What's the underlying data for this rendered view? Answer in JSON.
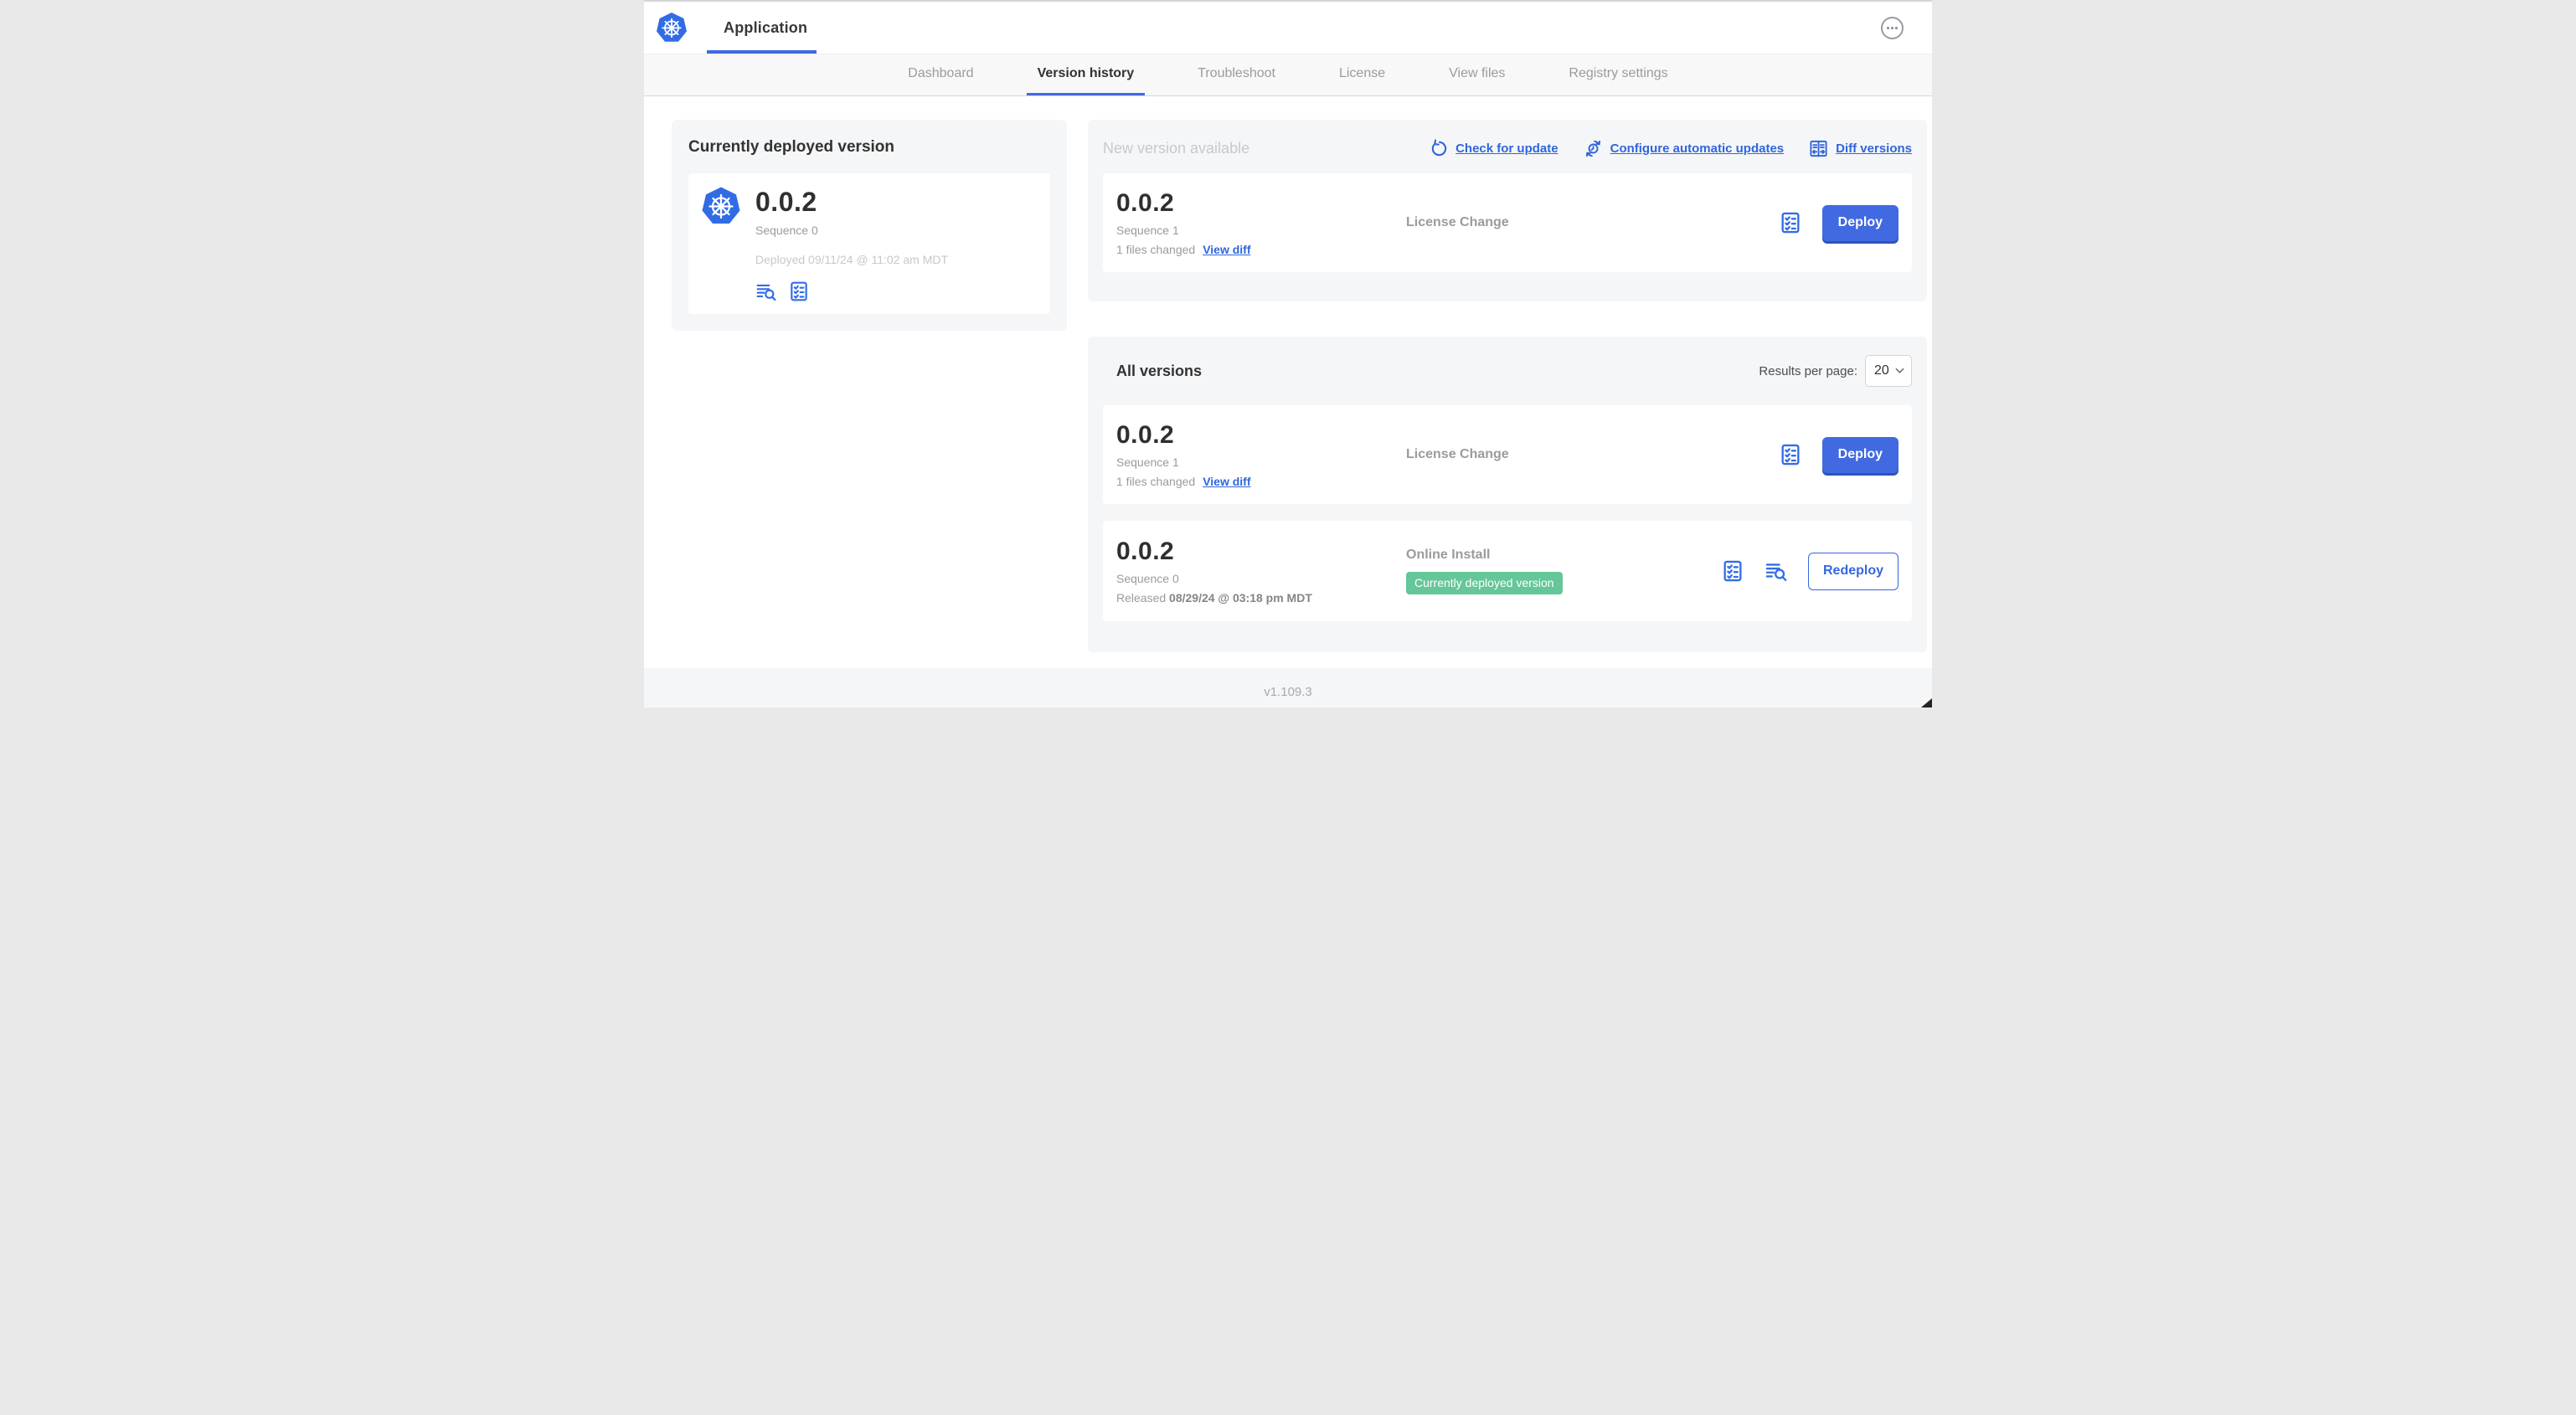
{
  "header": {
    "app_title": "Application"
  },
  "nav": {
    "tabs": [
      {
        "label": "Dashboard",
        "active": false
      },
      {
        "label": "Version history",
        "active": true
      },
      {
        "label": "Troubleshoot",
        "active": false
      },
      {
        "label": "License",
        "active": false
      },
      {
        "label": "View files",
        "active": false
      },
      {
        "label": "Registry settings",
        "active": false
      }
    ]
  },
  "current": {
    "title": "Currently deployed version",
    "version": "0.0.2",
    "sequence": "Sequence 0",
    "deployed": "Deployed 09/11/24 @ 11:02 am MDT"
  },
  "newVersion": {
    "title": "New version available",
    "actions": {
      "check": "Check for update",
      "configure": "Configure automatic updates",
      "diff": "Diff versions"
    },
    "row": {
      "version": "0.0.2",
      "sequence": "Sequence 1",
      "files_changed": "1 files changed",
      "view_diff": "View diff",
      "status": "License Change",
      "action": "Deploy"
    }
  },
  "allVersions": {
    "title": "All versions",
    "results_per_page_label": "Results per page:",
    "results_per_page_value": "20",
    "rows": [
      {
        "version": "0.0.2",
        "sequence": "Sequence 1",
        "files_changed": "1 files changed",
        "view_diff": "View diff",
        "status": "License Change",
        "action": "Deploy"
      },
      {
        "version": "0.0.2",
        "sequence": "Sequence 0",
        "released_prefix": "Released",
        "released_date": "08/29/24 @ 03:18 pm MDT",
        "status": "Online Install",
        "badge": "Currently deployed version",
        "action": "Redeploy"
      }
    ]
  },
  "footer": {
    "version": "v1.109.3"
  },
  "colors": {
    "primary_link_blue": "#2f66dd",
    "icon_blue": "#326de6",
    "button_blue": "#4169e1",
    "badge_green": "#65c699",
    "text_dark": "#323232",
    "text_gray": "#9b9b9b",
    "card_gray": "#f5f6f8"
  },
  "icons": {
    "kubernetes-logo-icon": "blue heptagon with white ship wheel",
    "more-options-icon": "horizontal ellipsis in circle",
    "view-logs-icon": "text lines with magnifying glass",
    "preflight-checks-icon": "clipboard checklist",
    "refresh-icon": "circular arrow",
    "schedule-update-icon": "clock with circular arrows",
    "diff-icon": "split panel with left/right arrows",
    "chevron-down-icon": "dropdown chevron"
  }
}
